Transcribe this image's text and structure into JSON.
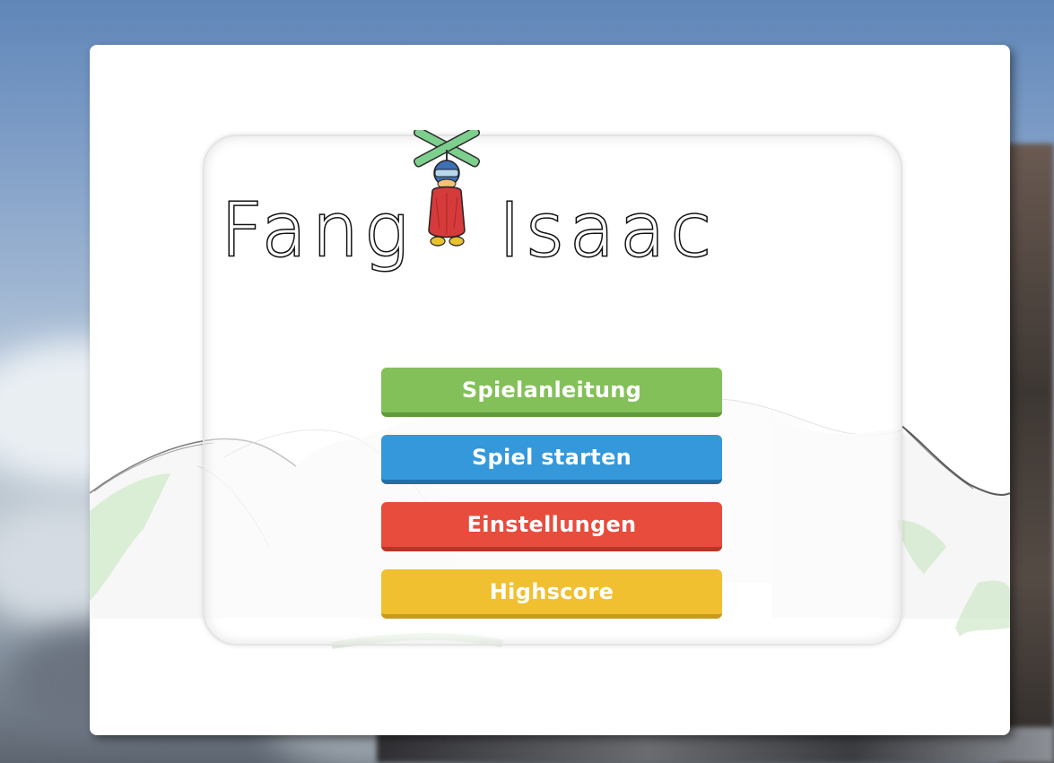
{
  "game": {
    "title_part1": "Fang",
    "title_part2": "Isaac",
    "mascot_icon": "helicopter-boy-mascot-icon"
  },
  "menu": {
    "buttons": [
      {
        "id": "instructions",
        "label": "Spielanleitung",
        "color": "#84c05a"
      },
      {
        "id": "start",
        "label": "Spiel starten",
        "color": "#3498db"
      },
      {
        "id": "settings",
        "label": "Einstellungen",
        "color": "#e74c3c"
      },
      {
        "id": "highscore",
        "label": "Highscore",
        "color": "#f0c030"
      }
    ]
  },
  "theme": {
    "card_background": "#ffffff",
    "sky_color": "#6a8fc0"
  }
}
